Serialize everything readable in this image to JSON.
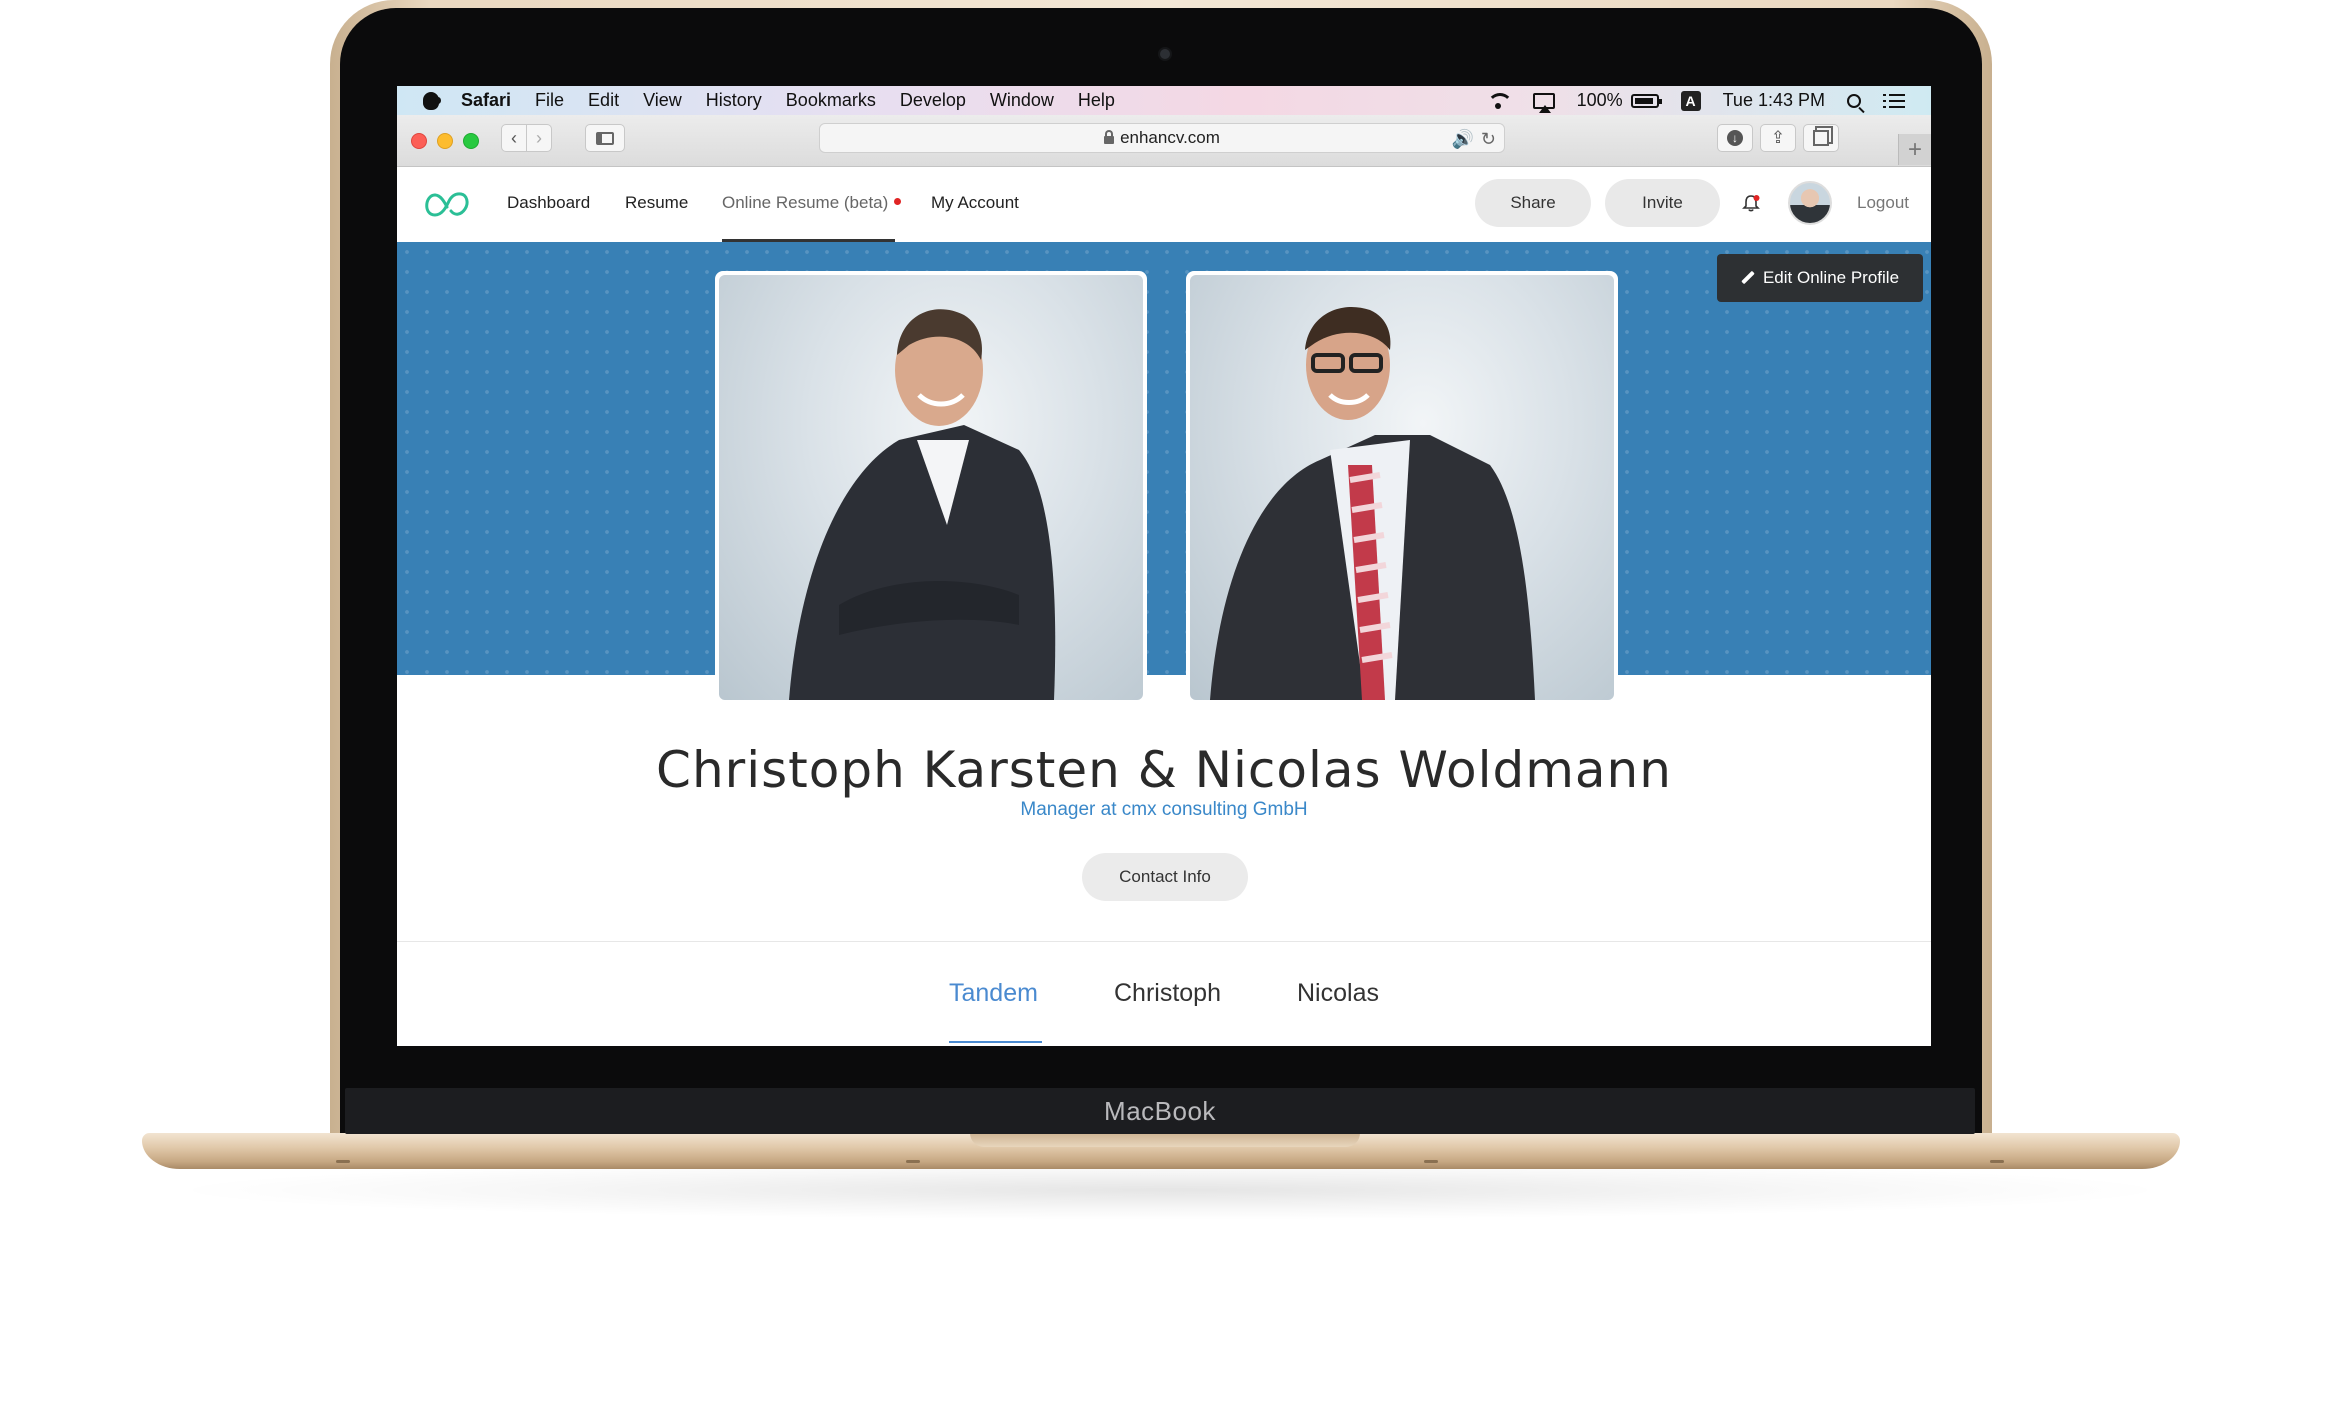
{
  "device": {
    "brand": "MacBook"
  },
  "mac_menubar": {
    "app": "Safari",
    "menus": [
      "File",
      "Edit",
      "View",
      "History",
      "Bookmarks",
      "Develop",
      "Window",
      "Help"
    ],
    "battery": "100%",
    "input_source": "A",
    "clock": "Tue 1:43 PM"
  },
  "browser": {
    "url": "enhancv.com"
  },
  "site_nav": {
    "links": [
      "Dashboard",
      "Resume",
      "Online Resume (beta)",
      "My Account"
    ],
    "active_link": "Online Resume (beta)",
    "share_label": "Share",
    "invite_label": "Invite",
    "logout_label": "Logout"
  },
  "profile": {
    "edit_label": "Edit Online Profile",
    "name": "Christoph Karsten & Nicolas Woldmann",
    "headline": "Manager at cmx consulting GmbH",
    "contact_label": "Contact Info",
    "tabs": [
      "Tandem",
      "Christoph",
      "Nicolas"
    ],
    "active_tab": "Tandem"
  },
  "colors": {
    "banner": "#3880b5",
    "accent_blue": "#4a8ad0",
    "logo_green": "#2bbf96",
    "notification_red": "#e02424"
  }
}
